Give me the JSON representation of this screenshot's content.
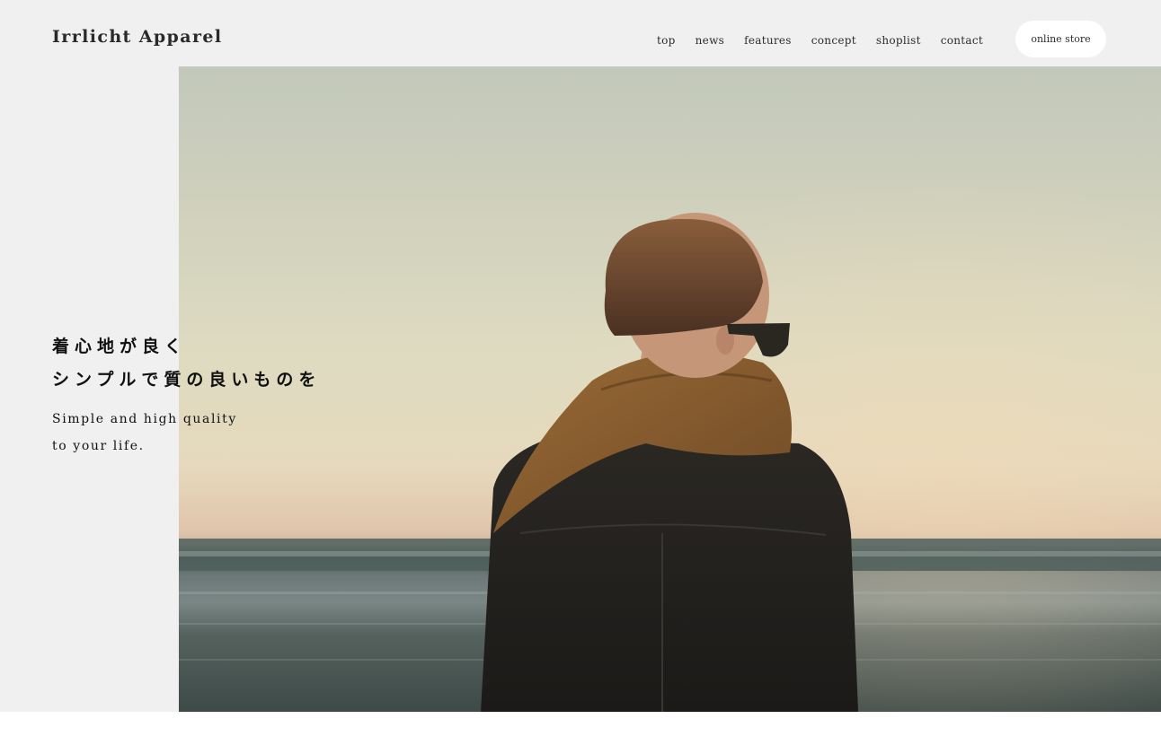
{
  "brand": {
    "logo_text": "Irrlicht Apparel"
  },
  "nav": {
    "items": [
      {
        "label": "top"
      },
      {
        "label": "news"
      },
      {
        "label": "features"
      },
      {
        "label": "concept"
      },
      {
        "label": "shoplist"
      },
      {
        "label": "contact"
      }
    ],
    "cta_label": "online store"
  },
  "hero": {
    "headline_line1": "着心地が良く",
    "headline_line2": "シンプルで質の良いものを",
    "sub_line1": "Simple and high quality",
    "sub_line2": "to your life."
  },
  "colors": {
    "header_bg": "#f0f0f0",
    "text": "#1f1f1f",
    "button_bg": "#ffffff"
  }
}
